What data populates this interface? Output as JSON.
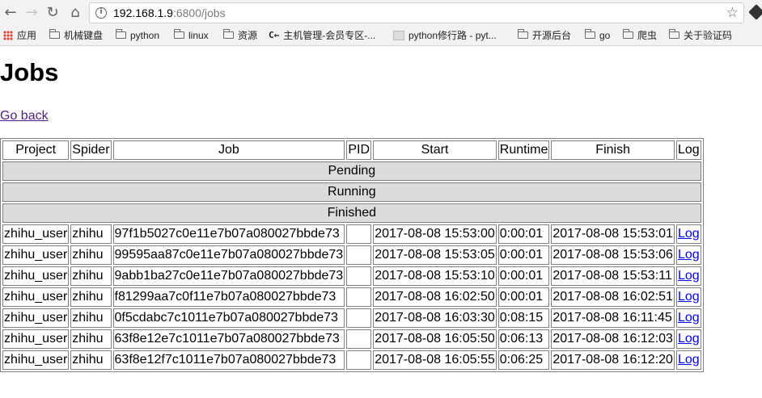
{
  "browser": {
    "url_host": "192.168.1.9",
    "url_rest": ":6800/jobs",
    "bookmarks": [
      {
        "label": "应用",
        "icon": "apps-grid-icon"
      },
      {
        "label": "机械键盘",
        "icon": "folder-icon"
      },
      {
        "label": "python",
        "icon": "folder-icon"
      },
      {
        "label": "linux",
        "icon": "folder-icon"
      },
      {
        "label": "资源",
        "icon": "folder-icon"
      },
      {
        "label": "主机管理-会员专区-...",
        "icon": "site-favicon"
      },
      {
        "label": "python修行路 - pyt...",
        "icon": "site-favicon"
      },
      {
        "label": "开源后台",
        "icon": "folder-icon"
      },
      {
        "label": "go",
        "icon": "folder-icon"
      },
      {
        "label": "爬虫",
        "icon": "folder-icon"
      },
      {
        "label": "关于验证码",
        "icon": "folder-icon"
      }
    ]
  },
  "page": {
    "title": "Jobs",
    "back_link": "Go back"
  },
  "table": {
    "headers": [
      "Project",
      "Spider",
      "Job",
      "PID",
      "Start",
      "Runtime",
      "Finish",
      "Log"
    ],
    "sections": [
      "Pending",
      "Running",
      "Finished"
    ],
    "finished_rows": [
      {
        "project": "zhihu_user",
        "spider": "zhihu",
        "job": "97f1b5027c0e11e7b07a080027bbde73",
        "pid": "",
        "start": "2017-08-08 15:53:00",
        "runtime": "0:00:01",
        "finish": "2017-08-08 15:53:01",
        "log": "Log"
      },
      {
        "project": "zhihu_user",
        "spider": "zhihu",
        "job": "99595aa87c0e11e7b07a080027bbde73",
        "pid": "",
        "start": "2017-08-08 15:53:05",
        "runtime": "0:00:01",
        "finish": "2017-08-08 15:53:06",
        "log": "Log"
      },
      {
        "project": "zhihu_user",
        "spider": "zhihu",
        "job": "9abb1ba27c0e11e7b07a080027bbde73",
        "pid": "",
        "start": "2017-08-08 15:53:10",
        "runtime": "0:00:01",
        "finish": "2017-08-08 15:53:11",
        "log": "Log"
      },
      {
        "project": "zhihu_user",
        "spider": "zhihu",
        "job": "f81299aa7c0f11e7b07a080027bbde73",
        "pid": "",
        "start": "2017-08-08 16:02:50",
        "runtime": "0:00:01",
        "finish": "2017-08-08 16:02:51",
        "log": "Log"
      },
      {
        "project": "zhihu_user",
        "spider": "zhihu",
        "job": "0f5cdabc7c1011e7b07a080027bbde73",
        "pid": "",
        "start": "2017-08-08 16:03:30",
        "runtime": "0:08:15",
        "finish": "2017-08-08 16:11:45",
        "log": "Log"
      },
      {
        "project": "zhihu_user",
        "spider": "zhihu",
        "job": "63f8e12e7c1011e7b07a080027bbde73",
        "pid": "",
        "start": "2017-08-08 16:05:50",
        "runtime": "0:06:13",
        "finish": "2017-08-08 16:12:03",
        "log": "Log"
      },
      {
        "project": "zhihu_user",
        "spider": "zhihu",
        "job": "63f8e12f7c1011e7b07a080027bbde73",
        "pid": "",
        "start": "2017-08-08 16:05:55",
        "runtime": "0:06:25",
        "finish": "2017-08-08 16:12:20",
        "log": "Log"
      }
    ]
  },
  "colors": {
    "section_bg": "#dcdcdc",
    "link_visited": "#551a8b",
    "link": "#0000ee"
  }
}
